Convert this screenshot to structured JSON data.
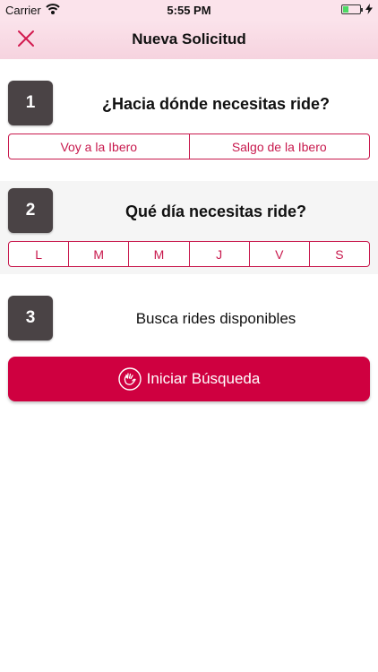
{
  "status": {
    "carrier": "Carrier",
    "time": "5:55 PM"
  },
  "nav": {
    "title": "Nueva Solicitud"
  },
  "step1": {
    "number": "1",
    "title": "¿Hacia dónde necesitas ride?",
    "options": [
      "Voy a la Ibero",
      "Salgo de la Ibero"
    ]
  },
  "step2": {
    "number": "2",
    "title": "Qué día necesitas ride?",
    "days": [
      "L",
      "M",
      "M",
      "J",
      "V",
      "S"
    ]
  },
  "step3": {
    "number": "3",
    "title": "Busca rides disponibles",
    "button_label": "Iniciar Búsqueda"
  },
  "colors": {
    "accent": "#c8194d",
    "button": "#cf0040",
    "badge": "#4a4345",
    "header": "#fbe3eb"
  },
  "icons": {
    "close": "close-icon",
    "wifi": "wifi-icon",
    "battery": "battery-icon",
    "search_button": "hand-wave-icon"
  }
}
